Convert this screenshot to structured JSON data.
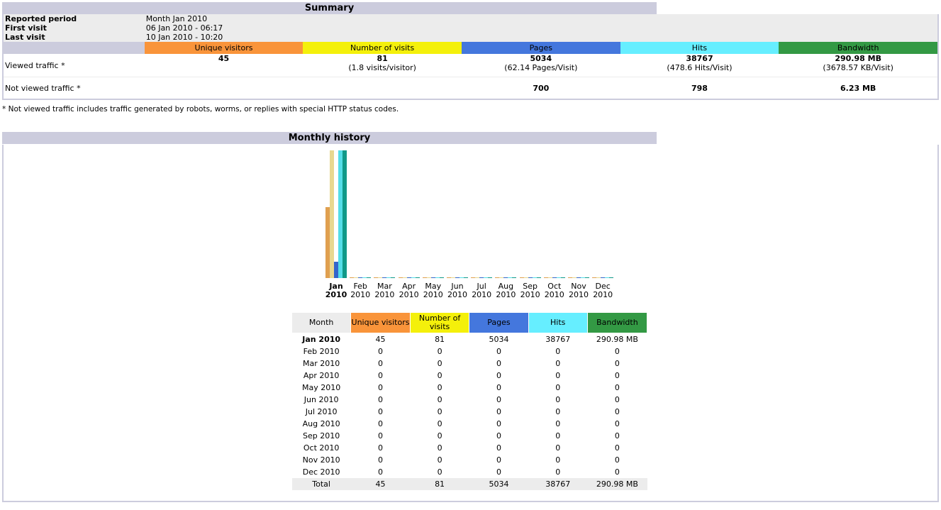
{
  "summary": {
    "title": "Summary",
    "reported_period_label": "Reported period",
    "reported_period": "Month Jan 2010",
    "first_visit_label": "First visit",
    "first_visit": "06 Jan 2010 - 06:17",
    "last_visit_label": "Last visit",
    "last_visit": "10 Jan 2010 - 10:20",
    "columns": [
      "Unique visitors",
      "Number of visits",
      "Pages",
      "Hits",
      "Bandwidth"
    ],
    "viewed_label": "Viewed traffic *",
    "viewed": [
      {
        "v": "45",
        "s": ""
      },
      {
        "v": "81",
        "s": "(1.8 visits/visitor)"
      },
      {
        "v": "5034",
        "s": "(62.14 Pages/Visit)"
      },
      {
        "v": "38767",
        "s": "(478.6 Hits/Visit)"
      },
      {
        "v": "290.98 MB",
        "s": "(3678.57 KB/Visit)"
      }
    ],
    "not_viewed_label": "Not viewed traffic *",
    "not_viewed": [
      "",
      "",
      "700",
      "798",
      "6.23 MB"
    ],
    "note": "* Not viewed traffic includes traffic generated by robots, worms, or replies with special HTTP status codes."
  },
  "colors": {
    "visitors": "#f9943a",
    "visits": "#f4f00b",
    "pages": "#4477dd",
    "hits": "#66eeff",
    "bandwidth": "#339944",
    "bar_visitors": "#e0a050",
    "bar_visits": "#e8d890",
    "bar_pages": "#3366cc",
    "bar_hits": "#55dde8",
    "bar_bandwidth": "#119988"
  },
  "history": {
    "title": "Monthly history",
    "headers": [
      "Month",
      "Unique visitors",
      "Number of visits",
      "Pages",
      "Hits",
      "Bandwidth"
    ],
    "rows": [
      [
        "Jan 2010",
        "45",
        "81",
        "5034",
        "38767",
        "290.98 MB"
      ],
      [
        "Feb 2010",
        "0",
        "0",
        "0",
        "0",
        "0"
      ],
      [
        "Mar 2010",
        "0",
        "0",
        "0",
        "0",
        "0"
      ],
      [
        "Apr 2010",
        "0",
        "0",
        "0",
        "0",
        "0"
      ],
      [
        "May 2010",
        "0",
        "0",
        "0",
        "0",
        "0"
      ],
      [
        "Jun 2010",
        "0",
        "0",
        "0",
        "0",
        "0"
      ],
      [
        "Jul 2010",
        "0",
        "0",
        "0",
        "0",
        "0"
      ],
      [
        "Aug 2010",
        "0",
        "0",
        "0",
        "0",
        "0"
      ],
      [
        "Sep 2010",
        "0",
        "0",
        "0",
        "0",
        "0"
      ],
      [
        "Oct 2010",
        "0",
        "0",
        "0",
        "0",
        "0"
      ],
      [
        "Nov 2010",
        "0",
        "0",
        "0",
        "0",
        "0"
      ],
      [
        "Dec 2010",
        "0",
        "0",
        "0",
        "0",
        "0"
      ]
    ],
    "total": [
      "Total",
      "45",
      "81",
      "5034",
      "38767",
      "290.98 MB"
    ]
  },
  "chart_data": {
    "type": "bar",
    "title": "Monthly history",
    "categories": [
      [
        "Jan",
        "2010"
      ],
      [
        "Feb",
        "2010"
      ],
      [
        "Mar",
        "2010"
      ],
      [
        "Apr",
        "2010"
      ],
      [
        "May",
        "2010"
      ],
      [
        "Jun",
        "2010"
      ],
      [
        "Jul",
        "2010"
      ],
      [
        "Aug",
        "2010"
      ],
      [
        "Sep",
        "2010"
      ],
      [
        "Oct",
        "2010"
      ],
      [
        "Nov",
        "2010"
      ],
      [
        "Dec",
        "2010"
      ]
    ],
    "series": [
      {
        "name": "Unique visitors",
        "values": [
          45,
          0,
          0,
          0,
          0,
          0,
          0,
          0,
          0,
          0,
          0,
          0
        ],
        "max": 81
      },
      {
        "name": "Number of visits",
        "values": [
          81,
          0,
          0,
          0,
          0,
          0,
          0,
          0,
          0,
          0,
          0,
          0
        ],
        "max": 81
      },
      {
        "name": "Pages",
        "values": [
          5034,
          0,
          0,
          0,
          0,
          0,
          0,
          0,
          0,
          0,
          0,
          0
        ],
        "max": 38767
      },
      {
        "name": "Hits",
        "values": [
          38767,
          0,
          0,
          0,
          0,
          0,
          0,
          0,
          0,
          0,
          0,
          0
        ],
        "max": 38767
      },
      {
        "name": "Bandwidth",
        "values": [
          290.98,
          0,
          0,
          0,
          0,
          0,
          0,
          0,
          0,
          0,
          0,
          0
        ],
        "max": 290.98
      }
    ]
  }
}
